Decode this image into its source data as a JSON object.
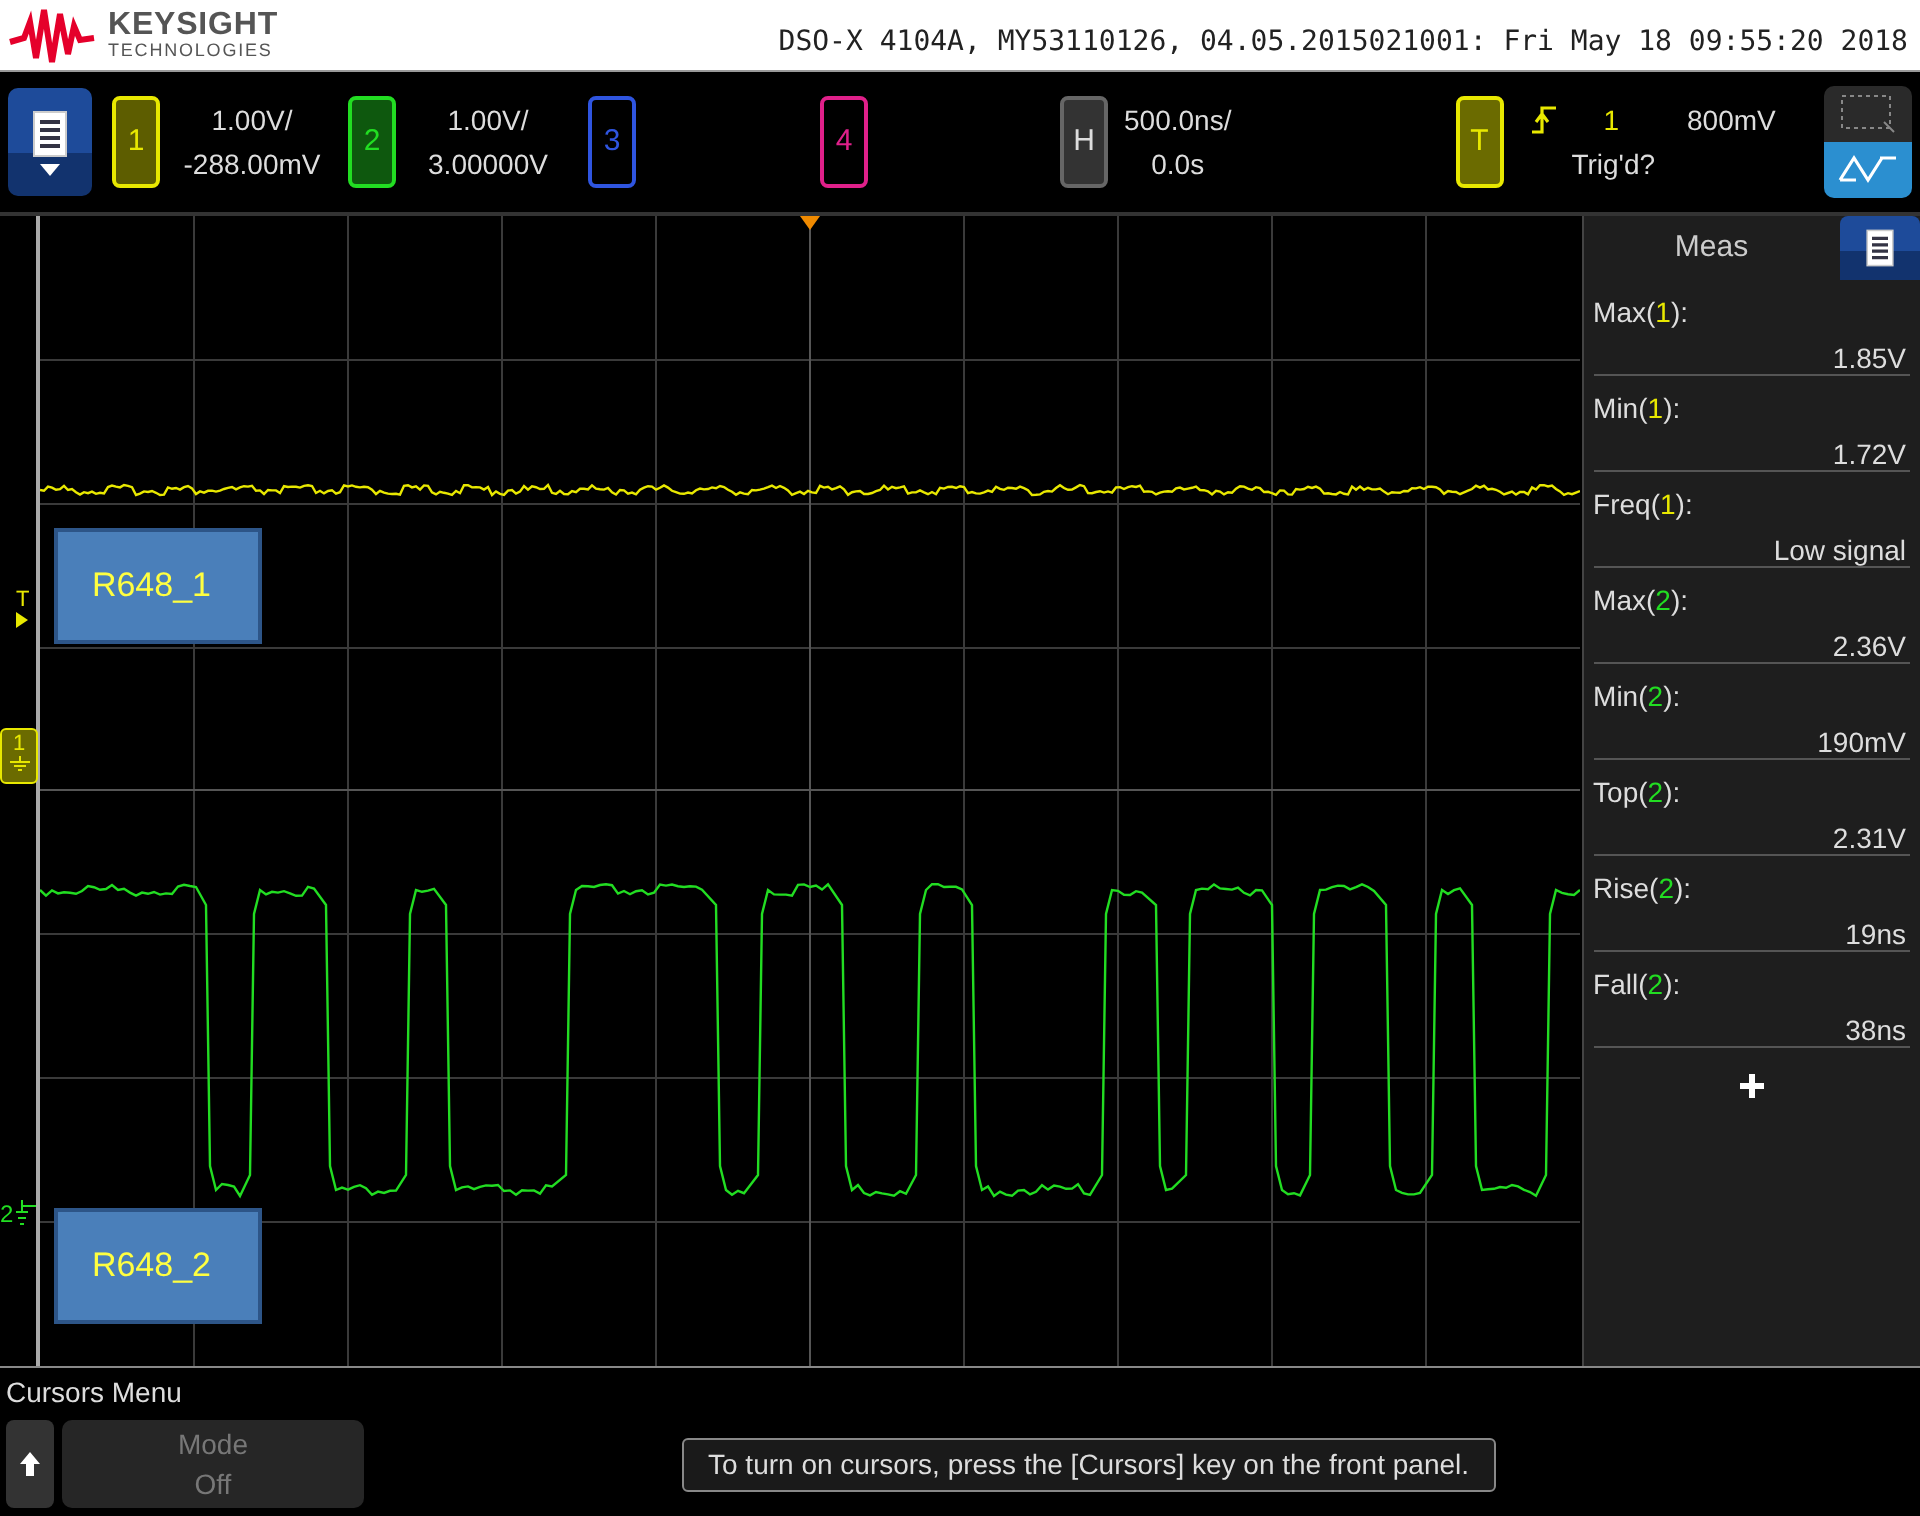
{
  "header": {
    "brand": "KEYSIGHT",
    "brand_sub": "TECHNOLOGIES",
    "instrument_info": "DSO-X 4104A, MY53110126, 04.05.2015021001: Fri May 18 09:55:20 2018"
  },
  "channels": [
    {
      "label": "1",
      "on": true,
      "color": "#e8e800",
      "scale": "1.00V/",
      "offset": "-288.00mV"
    },
    {
      "label": "2",
      "on": true,
      "color": "#22dd22",
      "scale": "1.00V/",
      "offset": "3.00000V"
    },
    {
      "label": "3",
      "on": false,
      "color": "#2f55e0"
    },
    {
      "label": "4",
      "on": false,
      "color": "#e0208a"
    }
  ],
  "horizontal": {
    "label": "H",
    "scale": "500.0ns/",
    "delay": "0.0s"
  },
  "trigger": {
    "label": "T",
    "source": "1",
    "level": "800mV",
    "status": "Trig'd?"
  },
  "markers": {
    "trigger_level": "T",
    "channel_1": "1",
    "channel_2": "2"
  },
  "trace_labels": [
    "R648_1",
    "R648_2"
  ],
  "measurements": {
    "title": "Meas",
    "items": [
      {
        "prefix": "Max(",
        "channel": "1",
        "suffix": "):",
        "color": "#e8e800",
        "value": "1.85V"
      },
      {
        "prefix": "Min(",
        "channel": "1",
        "suffix": "):",
        "color": "#e8e800",
        "value": "1.72V"
      },
      {
        "prefix": "Freq(",
        "channel": "1",
        "suffix": "):",
        "color": "#e8e800",
        "value": "Low signal"
      },
      {
        "prefix": "Max(",
        "channel": "2",
        "suffix": "):",
        "color": "#22dd22",
        "value": "2.36V"
      },
      {
        "prefix": "Min(",
        "channel": "2",
        "suffix": "):",
        "color": "#22dd22",
        "value": "190mV"
      },
      {
        "prefix": "Top(",
        "channel": "2",
        "suffix": "):",
        "color": "#22dd22",
        "value": "2.31V"
      },
      {
        "prefix": "Rise(",
        "channel": "2",
        "suffix": "):",
        "color": "#22dd22",
        "value": "19ns"
      },
      {
        "prefix": "Fall(",
        "channel": "2",
        "suffix": "):",
        "color": "#22dd22",
        "value": "38ns"
      }
    ]
  },
  "softkeys": {
    "menu_title": "Cursors Menu",
    "keys": [
      {
        "title": "Mode",
        "value": "Off",
        "disabled": true
      }
    ]
  },
  "message": "To turn on cursors, press the [Cursors] key on the front panel."
}
